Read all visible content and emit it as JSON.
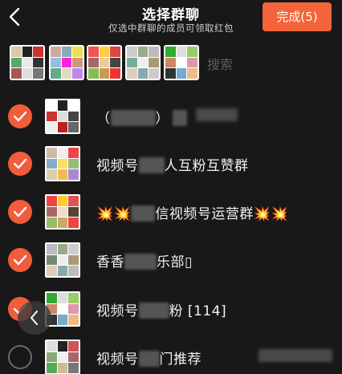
{
  "header": {
    "title": "选择群聊",
    "subtitle": "仅选中群聊的成员可领取红包",
    "done_label": "完成(5)"
  },
  "search": {
    "placeholder": "搜索"
  },
  "colors": {
    "accent": "#f3643a",
    "background": "#181818"
  },
  "groups": [
    {
      "name_pre": "（",
      "name_post": "）",
      "name_tail": "",
      "checked": true
    },
    {
      "name_pre": "视频号",
      "name_post": "人互粉互赞群",
      "name_tail": "",
      "checked": true
    },
    {
      "name_pre": "💥💥",
      "name_post": "信视频号运营群💥💥",
      "name_tail": "",
      "checked": true
    },
    {
      "name_pre": "香香",
      "name_post": "乐部▯",
      "name_tail": "",
      "checked": true
    },
    {
      "name_pre": "视频号",
      "name_post": "粉 [114]",
      "name_tail": "",
      "checked": true
    },
    {
      "name_pre": "视频号",
      "name_post": "门推荐",
      "name_tail": "",
      "checked": false
    }
  ],
  "icons": {
    "back": "chevron-left-icon",
    "check": "checkmark-icon",
    "search": "search-icon"
  }
}
